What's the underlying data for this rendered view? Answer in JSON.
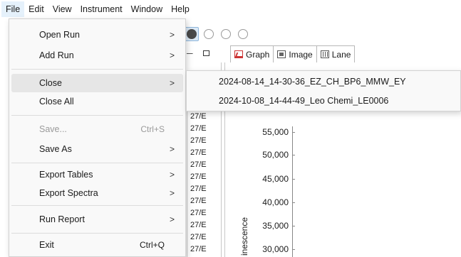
{
  "menubar": {
    "items": [
      "File",
      "Edit",
      "View",
      "Instrument",
      "Window",
      "Help"
    ]
  },
  "file_menu": {
    "items": [
      {
        "label": "Open Run",
        "shortcut": "",
        "arrow": ">"
      },
      {
        "label": "Add Run",
        "shortcut": "",
        "arrow": ">"
      },
      {
        "label": "Close",
        "shortcut": "",
        "arrow": ">"
      },
      {
        "label": "Close All",
        "shortcut": "",
        "arrow": ""
      },
      {
        "label": "Save...",
        "shortcut": "Ctrl+S",
        "arrow": ""
      },
      {
        "label": "Save As",
        "shortcut": "",
        "arrow": ">"
      },
      {
        "label": "Export Tables",
        "shortcut": "",
        "arrow": ">"
      },
      {
        "label": "Export Spectra",
        "shortcut": "",
        "arrow": ">"
      },
      {
        "label": "Run Report",
        "shortcut": "",
        "arrow": ">"
      },
      {
        "label": "Exit",
        "shortcut": "Ctrl+Q",
        "arrow": ""
      }
    ],
    "highlighted": "Close",
    "disabled": [
      "Save..."
    ]
  },
  "close_submenu": {
    "items": [
      "2024-08-14_14-30-36_EZ_CH_BP6_MMW_EY",
      "2024-10-08_14-44-49_Leo Chemi_LE0006"
    ]
  },
  "tabs": [
    {
      "label": "Graph",
      "icon": "graph-icon"
    },
    {
      "label": "Image",
      "icon": "image-icon"
    },
    {
      "label": "Lane",
      "icon": "lane-icon"
    }
  ],
  "run_list": {
    "rows": [
      "27/E",
      "27/E",
      "27/E",
      "27/E",
      "27/E",
      "27/E",
      "27/E",
      "27/E",
      "27/E",
      "27/E",
      "27/E",
      "27/E"
    ]
  },
  "chart": {
    "y_ticks": [
      "55,000",
      "50,000",
      "45,000",
      "40,000",
      "35,000",
      "30,000"
    ],
    "y_label": "inescence"
  },
  "colors": {
    "menu_bg": "#f9f9f9",
    "hover_bg": "#e6e6e6",
    "menubar_active": "#e5f1fb",
    "disabled_text": "#9a9a9a"
  }
}
